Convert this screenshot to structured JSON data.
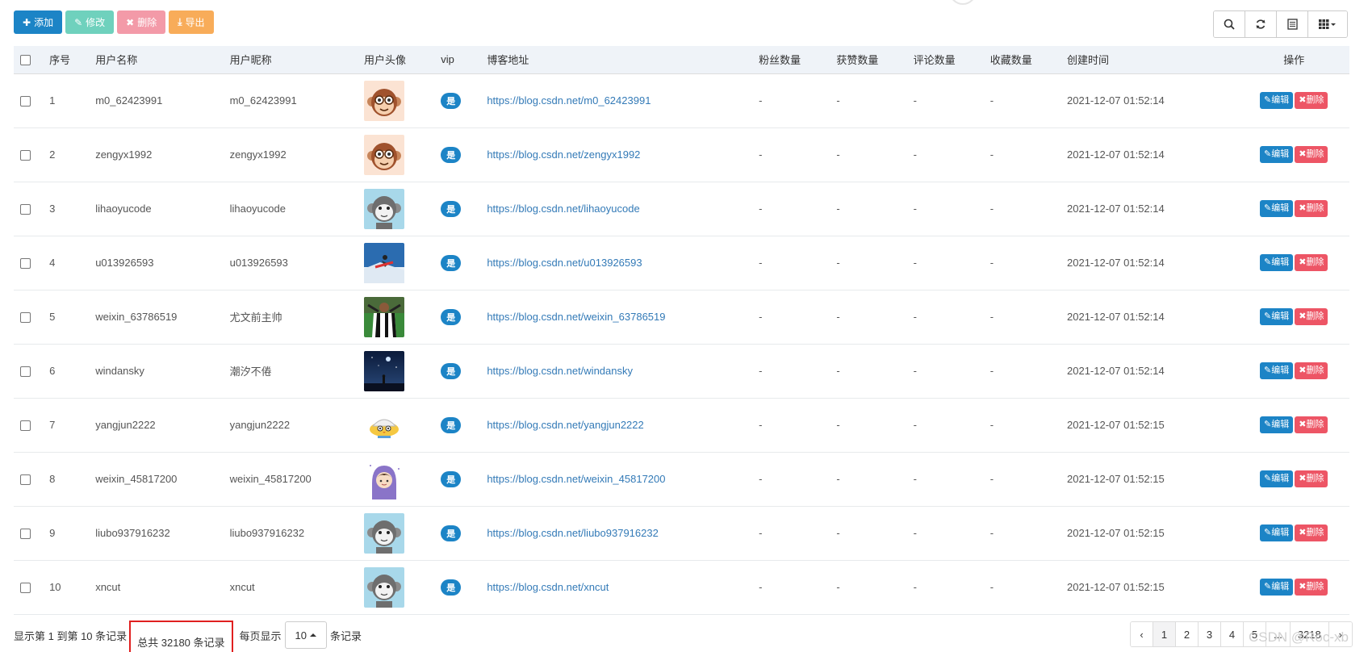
{
  "toolbar": {
    "add": "添加",
    "edit": "修改",
    "delete": "删除",
    "export": "导出"
  },
  "columns": [
    "序号",
    "用户名称",
    "用户昵称",
    "用户头像",
    "vip",
    "博客地址",
    "粉丝数量",
    "获赞数量",
    "评论数量",
    "收藏数量",
    "创建时间",
    "操作"
  ],
  "rows": [
    {
      "no": "1",
      "username": "m0_62423991",
      "nickname": "m0_62423991",
      "vip": "是",
      "url": "https://blog.csdn.net/m0_62423991",
      "fans": "-",
      "likes": "-",
      "comments": "-",
      "favs": "-",
      "created": "2021-12-07 01:52:14",
      "avatar": "monkey-glasses"
    },
    {
      "no": "2",
      "username": "zengyx1992",
      "nickname": "zengyx1992",
      "vip": "是",
      "url": "https://blog.csdn.net/zengyx1992",
      "fans": "-",
      "likes": "-",
      "comments": "-",
      "favs": "-",
      "created": "2021-12-07 01:52:14",
      "avatar": "monkey-glasses"
    },
    {
      "no": "3",
      "username": "lihaoyucode",
      "nickname": "lihaoyucode",
      "vip": "是",
      "url": "https://blog.csdn.net/lihaoyucode",
      "fans": "-",
      "likes": "-",
      "comments": "-",
      "favs": "-",
      "created": "2021-12-07 01:52:14",
      "avatar": "monkey-grey"
    },
    {
      "no": "4",
      "username": "u013926593",
      "nickname": "u013926593",
      "vip": "是",
      "url": "https://blog.csdn.net/u013926593",
      "fans": "-",
      "likes": "-",
      "comments": "-",
      "favs": "-",
      "created": "2021-12-07 01:52:14",
      "avatar": "snowboard-photo"
    },
    {
      "no": "5",
      "username": "weixin_63786519",
      "nickname": "尤文前主帅",
      "vip": "是",
      "url": "https://blog.csdn.net/weixin_63786519",
      "fans": "-",
      "likes": "-",
      "comments": "-",
      "favs": "-",
      "created": "2021-12-07 01:52:14",
      "avatar": "football-photo"
    },
    {
      "no": "6",
      "username": "windansky",
      "nickname": "潮汐不倦",
      "vip": "是",
      "url": "https://blog.csdn.net/windansky",
      "fans": "-",
      "likes": "-",
      "comments": "-",
      "favs": "-",
      "created": "2021-12-07 01:52:14",
      "avatar": "night-sky-photo"
    },
    {
      "no": "7",
      "username": "yangjun2222",
      "nickname": "yangjun2222",
      "vip": "是",
      "url": "https://blog.csdn.net/yangjun2222",
      "fans": "-",
      "likes": "-",
      "comments": "-",
      "favs": "-",
      "created": "2021-12-07 01:52:15",
      "avatar": "cartoon-chick"
    },
    {
      "no": "8",
      "username": "weixin_45817200",
      "nickname": "weixin_45817200",
      "vip": "是",
      "url": "https://blog.csdn.net/weixin_45817200",
      "fans": "-",
      "likes": "-",
      "comments": "-",
      "favs": "-",
      "created": "2021-12-07 01:52:15",
      "avatar": "cartoon-hoodie"
    },
    {
      "no": "9",
      "username": "liubo937916232",
      "nickname": "liubo937916232",
      "vip": "是",
      "url": "https://blog.csdn.net/liubo937916232",
      "fans": "-",
      "likes": "-",
      "comments": "-",
      "favs": "-",
      "created": "2021-12-07 01:52:15",
      "avatar": "monkey-grey"
    },
    {
      "no": "10",
      "username": "xncut",
      "nickname": "xncut",
      "vip": "是",
      "url": "https://blog.csdn.net/xncut",
      "fans": "-",
      "likes": "-",
      "comments": "-",
      "favs": "-",
      "created": "2021-12-07 01:52:15",
      "avatar": "monkey-grey"
    }
  ],
  "row_actions": {
    "edit": "编辑",
    "delete": "删除"
  },
  "footer": {
    "range": "显示第 1 到第 10 条记录",
    "total": "总共 32180 条记录",
    "per_page_prefix": "每页显示",
    "page_size": "10",
    "per_page_suffix": "条记录"
  },
  "pagination": [
    "‹",
    "1",
    "2",
    "3",
    "4",
    "5",
    "...",
    "3218",
    "›"
  ],
  "watermark": "CSDN @Roc-xb",
  "colors": {
    "primary": "#1c84c6",
    "danger": "#ed5565",
    "teal": "#6fd1bd",
    "warning": "#f8ac59",
    "header_bg": "#eff3f8",
    "highlight_box": "#e02020"
  }
}
